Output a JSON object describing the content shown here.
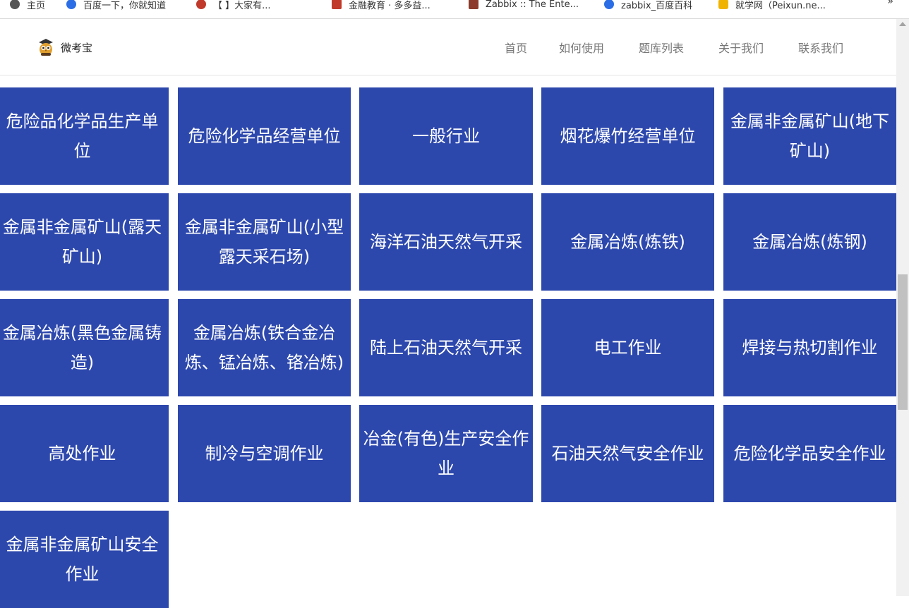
{
  "bookmarks": [
    {
      "label": "主页",
      "icon": "globe-icon",
      "color": "#555555"
    },
    {
      "label": "百度一下，你就知道",
      "icon": "baidu-paw-icon",
      "color": "#2b6de5"
    },
    {
      "label": "【       】大家有...",
      "icon": "pound-icon",
      "color": "#c0392b"
    },
    {
      "label": "金融教育 · 多多益...",
      "icon": "stripes-icon",
      "color": "#c0392b"
    },
    {
      "label": "Zabbix :: The Ente...",
      "icon": "zabbix-icon",
      "color": "#8b3a2b"
    },
    {
      "label": "zabbix_百度百科",
      "icon": "baidu-paw-icon",
      "color": "#2b6de5"
    },
    {
      "label": "就学网（Peixun.ne...",
      "icon": "peixun-icon",
      "color": "#f0b400"
    }
  ],
  "bookmarks_more": "»",
  "site": {
    "name": "微考宝",
    "logo_icon": "owl-mascot-icon"
  },
  "nav": [
    "首页",
    "如何使用",
    "题库列表",
    "关于我们",
    "联系我们"
  ],
  "tile_color": "#2d48ad",
  "tiles": [
    [
      "危险品化学品生产单",
      "位"
    ],
    [
      "危险化学品经营单位"
    ],
    [
      "一般行业"
    ],
    [
      "烟花爆竹经营单位"
    ],
    [
      "金属非金属矿山(地下",
      "矿山)"
    ],
    [
      "金属非金属矿山(露天",
      "矿山)"
    ],
    [
      "金属非金属矿山(小型",
      "露天采石场)"
    ],
    [
      "海洋石油天然气开采"
    ],
    [
      "金属冶炼(炼铁)"
    ],
    [
      "金属冶炼(炼钢)"
    ],
    [
      "金属冶炼(黑色金属铸",
      "造)"
    ],
    [
      "金属冶炼(铁合金冶",
      "炼、锰冶炼、铬冶炼)"
    ],
    [
      "陆上石油天然气开采"
    ],
    [
      "电工作业"
    ],
    [
      "焊接与热切割作业"
    ],
    [
      "高处作业"
    ],
    [
      "制冷与空调作业"
    ],
    [
      "冶金(有色)生产安全作",
      "业"
    ],
    [
      "石油天然气安全作业"
    ],
    [
      "危险化学品安全作业"
    ],
    [
      "金属非金属矿山安全",
      "作业"
    ]
  ]
}
